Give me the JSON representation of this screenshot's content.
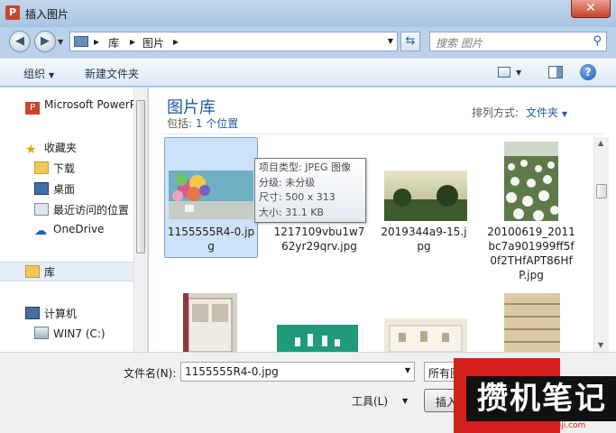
{
  "window": {
    "title": "插入图片",
    "app_icon_letter": "P"
  },
  "nav": {
    "breadcrumbs": [
      "库",
      "图片"
    ],
    "search_placeholder": "搜索 图片"
  },
  "toolbar": {
    "organize_label": "组织",
    "new_folder_label": "新建文件夹"
  },
  "sidebar": {
    "items": [
      {
        "label": "Microsoft PowerP",
        "icon": "powerpoint-icon"
      },
      {
        "label": "收藏夹",
        "icon": "star-icon"
      },
      {
        "label": "下载",
        "icon": "download-folder-icon"
      },
      {
        "label": "桌面",
        "icon": "desktop-icon"
      },
      {
        "label": "最近访问的位置",
        "icon": "recent-places-icon"
      },
      {
        "label": "OneDrive",
        "icon": "onedrive-icon"
      },
      {
        "label": "库",
        "icon": "library-icon"
      },
      {
        "label": "计算机",
        "icon": "computer-icon"
      },
      {
        "label": "WIN7 (C:)",
        "icon": "drive-icon"
      }
    ]
  },
  "library": {
    "title": "图片库",
    "includes_prefix": "包括: ",
    "includes_link": "1 个位置",
    "arrange_label": "排列方式:",
    "arrange_value": "文件夹"
  },
  "files": [
    {
      "name_lines": [
        "1155555R4-0.jp",
        "g"
      ],
      "selected": true
    },
    {
      "name_lines": [
        "1217109vbu1w7",
        "62yr29qrv.jpg"
      ]
    },
    {
      "name_lines": [
        "2019344a9-15.j",
        "pg"
      ]
    },
    {
      "name_lines": [
        "20100619_2011",
        "bc7a901999ff5f",
        "0f2THfAPT86Hf",
        "P.jpg"
      ]
    }
  ],
  "tooltip": {
    "lines": [
      "项目类型: JPEG 图像",
      "分级: 未分级",
      "尺寸: 500 x 313",
      "大小: 31.1 KB"
    ]
  },
  "footer": {
    "filename_label": "文件名(N):",
    "filename_value": "1155555R4-0.jpg",
    "filetype_value": "所有图",
    "tools_label": "工具(L)",
    "insert_label": "插入"
  },
  "watermark": {
    "text": "攒机笔记",
    "url": "www.cuanjibiji.com"
  }
}
